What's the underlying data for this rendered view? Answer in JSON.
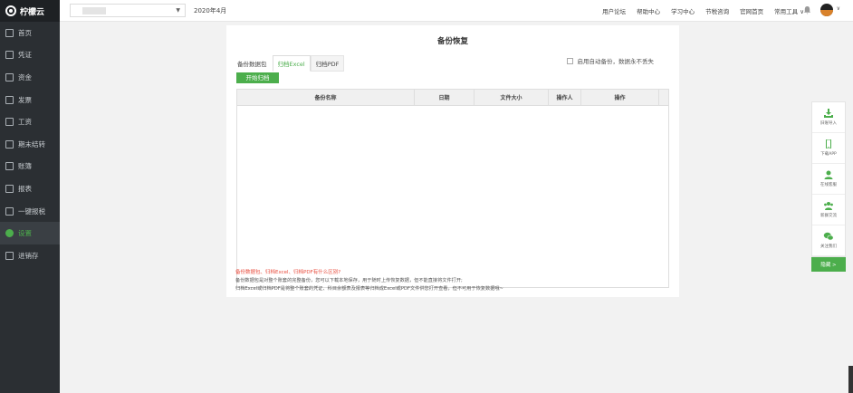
{
  "app": {
    "brand": "柠檬云"
  },
  "sidebar": {
    "items": [
      {
        "label": "首页",
        "icon": "home-icon"
      },
      {
        "label": "凭证",
        "icon": "voucher-icon"
      },
      {
        "label": "资金",
        "icon": "fund-icon"
      },
      {
        "label": "发票",
        "icon": "invoice-icon"
      },
      {
        "label": "工资",
        "icon": "salary-icon"
      },
      {
        "label": "期末结转",
        "icon": "period-end-icon"
      },
      {
        "label": "账簿",
        "icon": "ledger-icon"
      },
      {
        "label": "报表",
        "icon": "report-icon"
      },
      {
        "label": "一键报税",
        "icon": "tax-icon"
      },
      {
        "label": "设置",
        "icon": "gear-icon",
        "active": true
      },
      {
        "label": "进销存",
        "icon": "inventory-icon"
      }
    ]
  },
  "header": {
    "period": "2020年4月",
    "links": [
      "用户论坛",
      "帮助中心",
      "学习中心",
      "节税咨询",
      "官网首页",
      "常用工具 ∨"
    ]
  },
  "main": {
    "title": "备份恢复",
    "tabs": [
      "备份数据包",
      "归档Excel",
      "归档PDF"
    ],
    "active_tab": "归档Excel",
    "auto_backup_label": "启用自动备份，数据永不丢失",
    "start_button": "开始归档",
    "columns": [
      "备份名称",
      "日期",
      "文件大小",
      "操作人",
      "操作"
    ],
    "rows": []
  },
  "notes": {
    "question": "备份数据包、归档Excel、归档PDF有什么区别?",
    "line1": "备份数据包是对整个账套的完整备份，您可以下载本地保存，用于随时上传恢复数据，但不能直接将文件打开;",
    "line2": "归档Excel或归档PDF是将整个账套的凭证、科目余额表及报表等归档成Excel或PDF文件供您打开查看，但不可用于恢复数据哦~"
  },
  "floatbar": {
    "items": [
      {
        "label": "旧账导入",
        "icon": "download-icon"
      },
      {
        "label": "下载APP",
        "icon": "phone-icon"
      },
      {
        "label": "在线客服",
        "icon": "user-icon"
      },
      {
        "label": "新群交流",
        "icon": "group-icon"
      },
      {
        "label": "关注我们",
        "icon": "wechat-icon"
      }
    ],
    "fold_label": "隐藏 >"
  },
  "colors": {
    "accent": "#4cae4c",
    "sidebar_bg": "#2b2f33",
    "alert": "#e84c3d"
  }
}
